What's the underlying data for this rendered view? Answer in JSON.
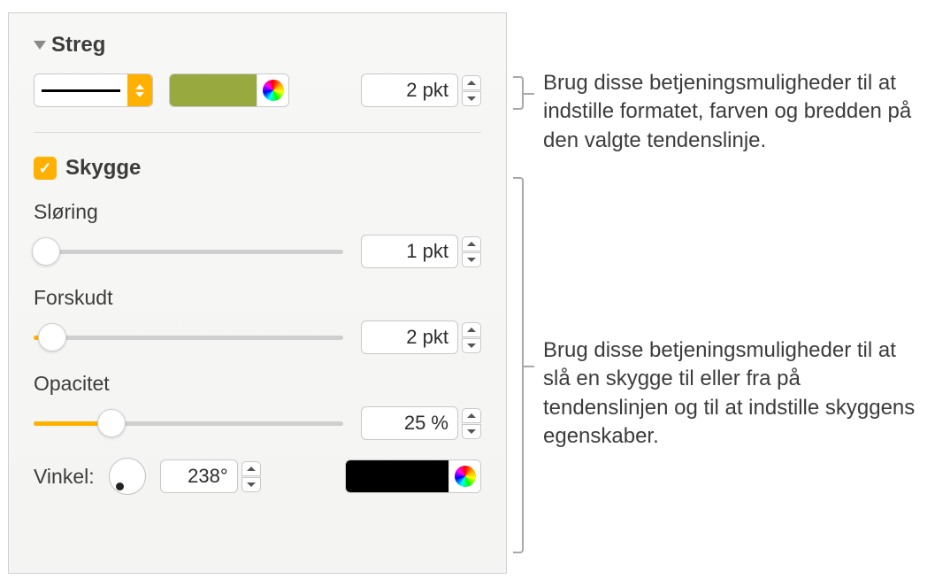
{
  "streg": {
    "title": "Streg",
    "width_value": "2 pkt",
    "color": "#97a93f"
  },
  "skygge": {
    "label": "Skygge",
    "checked": true,
    "sloring": {
      "label": "Sløring",
      "value": "1 pkt",
      "percent": 2
    },
    "forskudt": {
      "label": "Forskudt",
      "value": "2 pkt",
      "percent": 4
    },
    "opacitet": {
      "label": "Opacitet",
      "value": "25 %",
      "percent": 25
    },
    "vinkel": {
      "label": "Vinkel:",
      "value": "238°",
      "color": "#000000"
    }
  },
  "callouts": {
    "streg": "Brug disse betjeningsmuligheder til at indstille formatet, farven og bredden på den valgte tendenslinje.",
    "skygge": "Brug disse betjeningsmuligheder til at slå en skygge til eller fra på tendenslinjen og til at indstille skyggens egenskaber."
  }
}
